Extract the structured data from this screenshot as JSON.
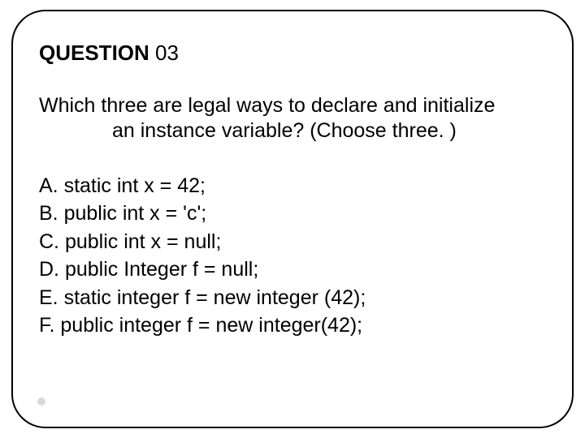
{
  "title": {
    "word": "QUESTION",
    "number": "03"
  },
  "prompt": {
    "line1": "Which three are legal ways to declare and initialize",
    "line2": "an instance variable? (Choose three. )"
  },
  "options": [
    "A. static int x = 42;",
    "B. public int x = 'c';",
    "C. public int x =  null;",
    "D. public Integer f = null;",
    "E. static integer f = new integer (42);",
    "F. public integer f = new integer(42);"
  ]
}
